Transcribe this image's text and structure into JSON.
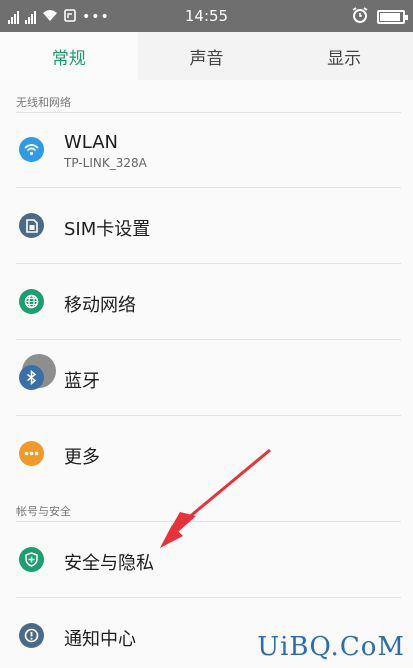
{
  "status_bar": {
    "time": "14:55",
    "battery_percent": 90,
    "icons": [
      "signal-icon",
      "signal-icon",
      "wifi-icon",
      "message-icon",
      "more-dots-icon",
      "alarm-icon",
      "battery-icon"
    ]
  },
  "tabs": [
    {
      "label": "常规",
      "active": true
    },
    {
      "label": "声音",
      "active": false
    },
    {
      "label": "显示",
      "active": false
    }
  ],
  "sections": {
    "wireless": "无线和网络",
    "account": "帐号与安全"
  },
  "items": {
    "wlan": {
      "label": "WLAN",
      "sub": "TP-LINK_328A",
      "icon": "wifi-icon",
      "color": "#2e9be6"
    },
    "sim": {
      "label": "SIM卡设置",
      "icon": "sim-card-icon",
      "color": "#4a6a86"
    },
    "mobile": {
      "label": "移动网络",
      "icon": "globe-icon",
      "color": "#1aa06e"
    },
    "bluetooth": {
      "label": "蓝牙",
      "icon": "bluetooth-icon",
      "color": "#3b6fa8"
    },
    "more": {
      "label": "更多",
      "icon": "more-dots-icon",
      "color": "#f19a2a"
    },
    "security": {
      "label": "安全与隐私",
      "icon": "shield-icon",
      "color": "#1aa06e"
    },
    "notification": {
      "label": "通知中心",
      "icon": "alert-icon",
      "color": "#4a6a86"
    }
  },
  "watermark": "UiBQ.CoM",
  "colors": {
    "accent": "#1a9a6a",
    "status_bar": "#6f6f6f",
    "arrow": "#e8323a"
  }
}
